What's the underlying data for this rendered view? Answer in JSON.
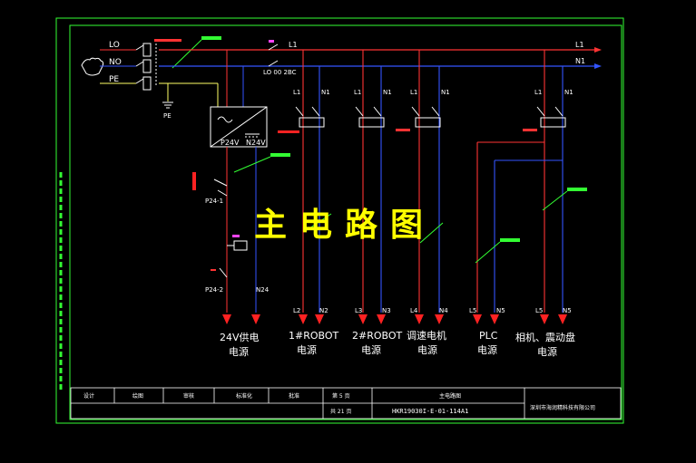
{
  "title": "主电路图",
  "inputs": {
    "l0": "LO",
    "n0": "NO",
    "pe": "PE",
    "pe_ground": "PE"
  },
  "bus_labels": {
    "l1_left": "L1",
    "n1_left": "N1",
    "l1_right": "L1",
    "n1_right": "N1",
    "l1_top": "L1"
  },
  "psu": {
    "p_out": "P24V",
    "n_out": "N24V"
  },
  "switch_labels": {
    "p24_1": "P24-1",
    "p24_2": "P24-2",
    "n24": "N24"
  },
  "branch_tops": [
    {
      "l": "L1",
      "n": "N1"
    },
    {
      "l": "L1",
      "n": "N1"
    },
    {
      "l": "L1",
      "n": "N1"
    },
    {
      "l": "L1",
      "n": "N1"
    }
  ],
  "branch_bottoms": [
    {
      "l": "L2",
      "n": "N2"
    },
    {
      "l": "L3",
      "n": "N3"
    },
    {
      "l": "L4",
      "n": "N4"
    },
    {
      "l": "L5",
      "n": "N5"
    },
    {
      "l": "L5",
      "n": "N5"
    }
  ],
  "destinations": [
    {
      "line1": "24V供电",
      "line2": "电源"
    },
    {
      "line1": "1#ROBOT",
      "line2": "电源"
    },
    {
      "line1": "2#ROBOT",
      "line2": "电源"
    },
    {
      "line1": "调速电机",
      "line2": "电源"
    },
    {
      "line1": "PLC",
      "line2": "电源"
    },
    {
      "line1": "相机、震动盘",
      "line2": "电源"
    }
  ],
  "title_block": {
    "designer": "设计",
    "drawn": "绘图",
    "checked": "审核",
    "standard": "标准化",
    "approved": "批准",
    "sheet": "第 5 页",
    "total": "共 21 页",
    "drawing_name": "主电路图",
    "drawing_code": "HKR19030I-E-01-114A1",
    "company": "深圳市海润精科技有限公司"
  },
  "colors": {
    "background": "#000000",
    "frame": "#33ff33",
    "live_wire": "#ff3333",
    "neutral_wire": "#3355ff",
    "pe_wire": "#ffff66",
    "component": "#ffffff",
    "title": "#ffff00",
    "arrow": "#ff2222",
    "leader": "#33ff33"
  }
}
